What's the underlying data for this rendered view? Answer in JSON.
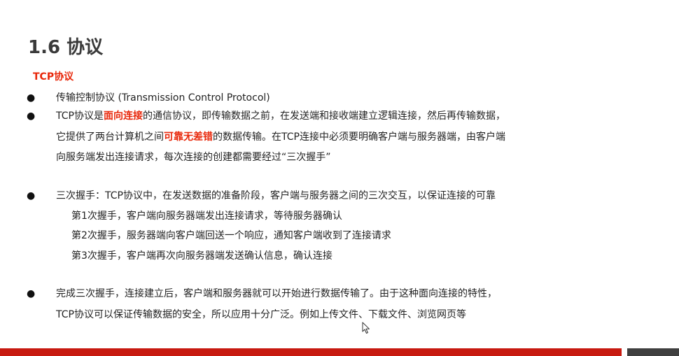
{
  "slide": {
    "title": "1.6 协议",
    "section_heading": "TCP协议"
  },
  "bullets": {
    "b1": {
      "symbol": "●",
      "text": "传输控制协议 (Transmission Control Protocol)"
    },
    "b2": {
      "symbol": "●",
      "line1_pre": "TCP协议是",
      "line1_hl": "面向连接",
      "line1_post": "的通信协议，即传输数据之前，在发送端和接收端建立逻辑连接，然后再传输数据，",
      "line2_pre": "它提供了两台计算机之间",
      "line2_hl": "可靠无差错",
      "line2_post": "的数据传输。在TCP连接中必须要明确客户端与服务器端，由客户端",
      "line3": "向服务端发出连接请求，每次连接的创建都需要经过“三次握手”"
    },
    "b3": {
      "symbol": "●",
      "text": "三次握手：TCP协议中，在发送数据的准备阶段，客户端与服务器之间的三次交互，以保证连接的可靠",
      "steps": [
        "第1次握手，客户端向服务器端发出连接请求，等待服务器确认",
        "第2次握手，服务器端向客户端回送一个响应，通知客户端收到了连接请求",
        "第3次握手，客户端再次向服务器端发送确认信息，确认连接"
      ]
    },
    "b4": {
      "symbol": "●",
      "line1": "完成三次握手，连接建立后，客户端和服务器就可以开始进行数据传输了。由于这种面向连接的特性，",
      "line2": "TCP协议可以保证传输数据的安全，所以应用十分广泛。例如上传文件、下载文件、浏览网页等"
    }
  },
  "colors": {
    "accent_red": "#e8270a",
    "bar_red": "#c71a10",
    "bar_gray": "#3f3f3f"
  },
  "icons": {
    "cursor": "mouse-pointer-icon"
  }
}
